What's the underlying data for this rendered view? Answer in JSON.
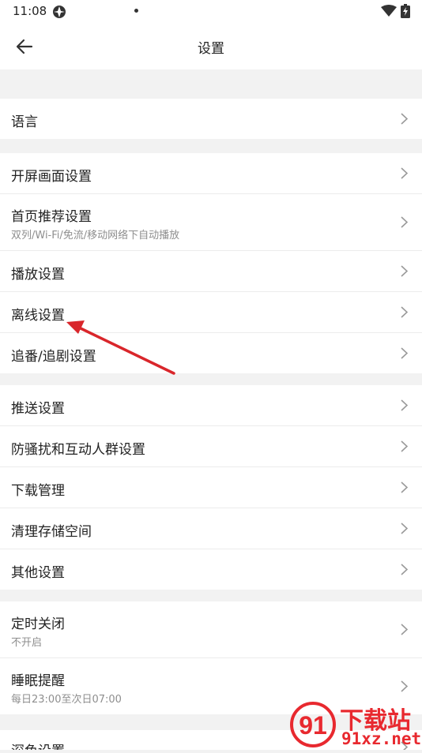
{
  "status": {
    "time": "11:08"
  },
  "header": {
    "title": "设置"
  },
  "sections": [
    {
      "rows": [
        {
          "label": "语言"
        }
      ]
    },
    {
      "rows": [
        {
          "label": "开屏画面设置"
        },
        {
          "label": "首页推荐设置",
          "sub": "双列/Wi-Fi/免流/移动网络下自动播放"
        },
        {
          "label": "播放设置"
        },
        {
          "label": "离线设置"
        },
        {
          "label": "追番/追剧设置"
        }
      ]
    },
    {
      "rows": [
        {
          "label": "推送设置"
        },
        {
          "label": "防骚扰和互动人群设置"
        },
        {
          "label": "下载管理"
        },
        {
          "label": "清理存储空间"
        },
        {
          "label": "其他设置"
        }
      ]
    },
    {
      "rows": [
        {
          "label": "定时关闭",
          "sub": "不开启"
        },
        {
          "label": "睡眠提醒",
          "sub": "每日23:00至次日07:00"
        }
      ]
    },
    {
      "rows": [
        {
          "label": "深色设置"
        }
      ]
    }
  ],
  "watermark": {
    "brand": "下载站",
    "site": "91xz.net",
    "logo_glyph": "91"
  },
  "colors": {
    "annotation_arrow": "#d9262b",
    "background": "#f2f2f2",
    "watermark": "#e8292f"
  }
}
